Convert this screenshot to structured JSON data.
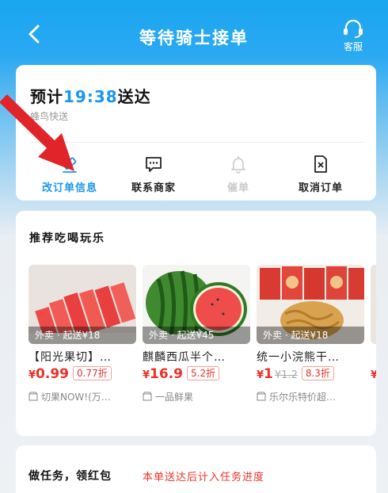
{
  "header": {
    "title": "等待骑士接单",
    "customer_service_label": "客服"
  },
  "order": {
    "eta_prefix": "预计",
    "eta_time": "19:38",
    "eta_suffix": "送达",
    "courier": "蜂鸟快送",
    "actions": [
      {
        "label": "改订单信息",
        "icon": "edit-icon"
      },
      {
        "label": "联系商家",
        "icon": "chat-icon"
      },
      {
        "label": "催单",
        "icon": "bell-icon"
      },
      {
        "label": "取消订单",
        "icon": "cancel-order-icon"
      }
    ]
  },
  "recommend": {
    "title": "推荐吃喝玩乐",
    "items": [
      {
        "name": "【阳光果切】…",
        "tag": "外卖 · 起送¥18",
        "currency": "¥",
        "price": "0.99",
        "old_price": "",
        "discount": "0.77折",
        "shop": "切果NOW!(万…"
      },
      {
        "name": "麒麟西瓜半个…",
        "tag": "外卖 · 起送¥45",
        "currency": "¥",
        "price": "16.9",
        "old_price": "",
        "discount": "5.2折",
        "shop": "一品鲜果"
      },
      {
        "name": "统一小浣熊干…",
        "tag": "外卖 · 起送¥18",
        "currency": "¥",
        "price": "1",
        "old_price": "¥1.2",
        "discount": "8.3折",
        "shop": "乐尔乐特价超…"
      },
      {
        "name": "",
        "tag": "",
        "currency": "¥",
        "price": "",
        "old_price": "",
        "discount": "",
        "shop": ""
      }
    ]
  },
  "tasks": {
    "title": "做任务，领红包",
    "note": "本单送达后计入任务进度"
  },
  "colors": {
    "accent_blue": "#1a96ee",
    "price_red": "#e8332a",
    "arrow_red": "#e0242a"
  }
}
